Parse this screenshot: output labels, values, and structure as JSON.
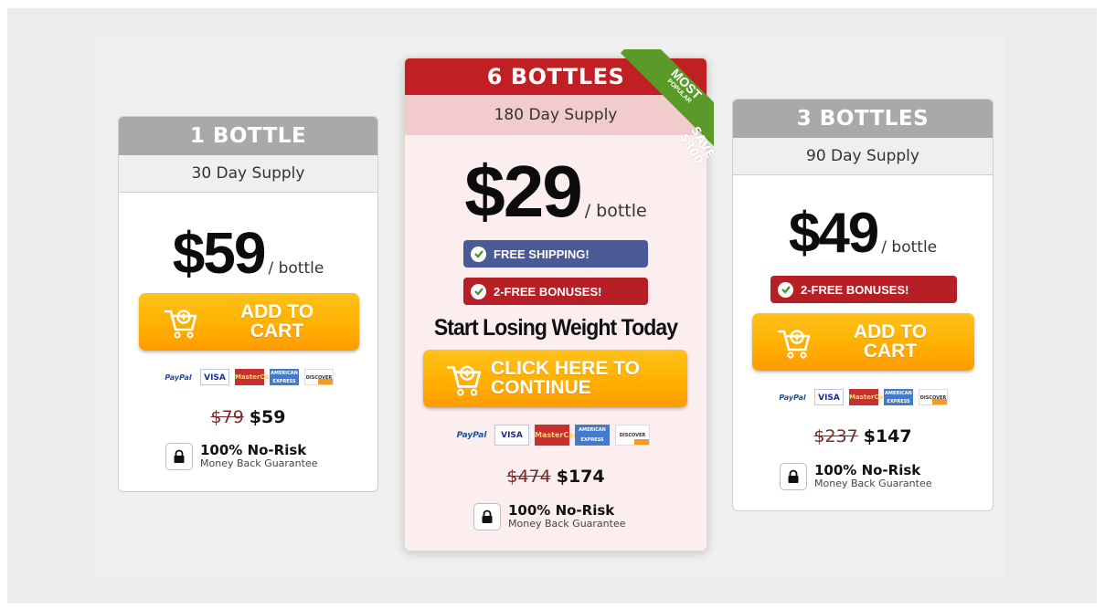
{
  "cards": {
    "left": {
      "title": "1 BOTTLE",
      "supply": "30 Day Supply",
      "price": "$59",
      "per": "/ bottle",
      "button_line1": "ADD TO",
      "button_line2": "CART",
      "old_total": "$79",
      "new_total": "$59"
    },
    "middle": {
      "title": "6 BOTTLES",
      "ribbon": "MOST",
      "ribbon_sub": "POPULAR",
      "save_line1": "SAVE",
      "save_line2": "$300",
      "supply": "180 Day Supply",
      "price": "$29",
      "per": "/ bottle",
      "badge_shipping": "FREE SHIPPING!",
      "badge_bonuses": "2-FREE BONUSES!",
      "headline": "Start Losing Weight Today",
      "button_line1": "CLICK HERE TO",
      "button_line2": "CONTINUE",
      "old_total": "$474",
      "new_total": "$174"
    },
    "right": {
      "title": "3 BOTTLES",
      "supply": "90 Day Supply",
      "price": "$49",
      "per": "/ bottle",
      "badge_bonuses": "2-FREE BONUSES!",
      "button_line1": "ADD TO",
      "button_line2": "CART",
      "old_total": "$237",
      "new_total": "$147"
    }
  },
  "payment": {
    "paypal": "PayPal",
    "visa": "VISA",
    "mastercard": "MasterCard",
    "amex": "AMERICAN EXPRESS",
    "discover": "DISCOVER"
  },
  "guarantee": {
    "title": "100% No-Risk",
    "subtitle": "Money Back Guarantee"
  },
  "colors": {
    "header_grey": "#a9a9a9",
    "header_red": "#c01f23",
    "ribbon_green": "#5a9a29",
    "button_orange": "#ffb000",
    "badge_blue": "#4a5a97",
    "badge_red": "#b51f25"
  }
}
